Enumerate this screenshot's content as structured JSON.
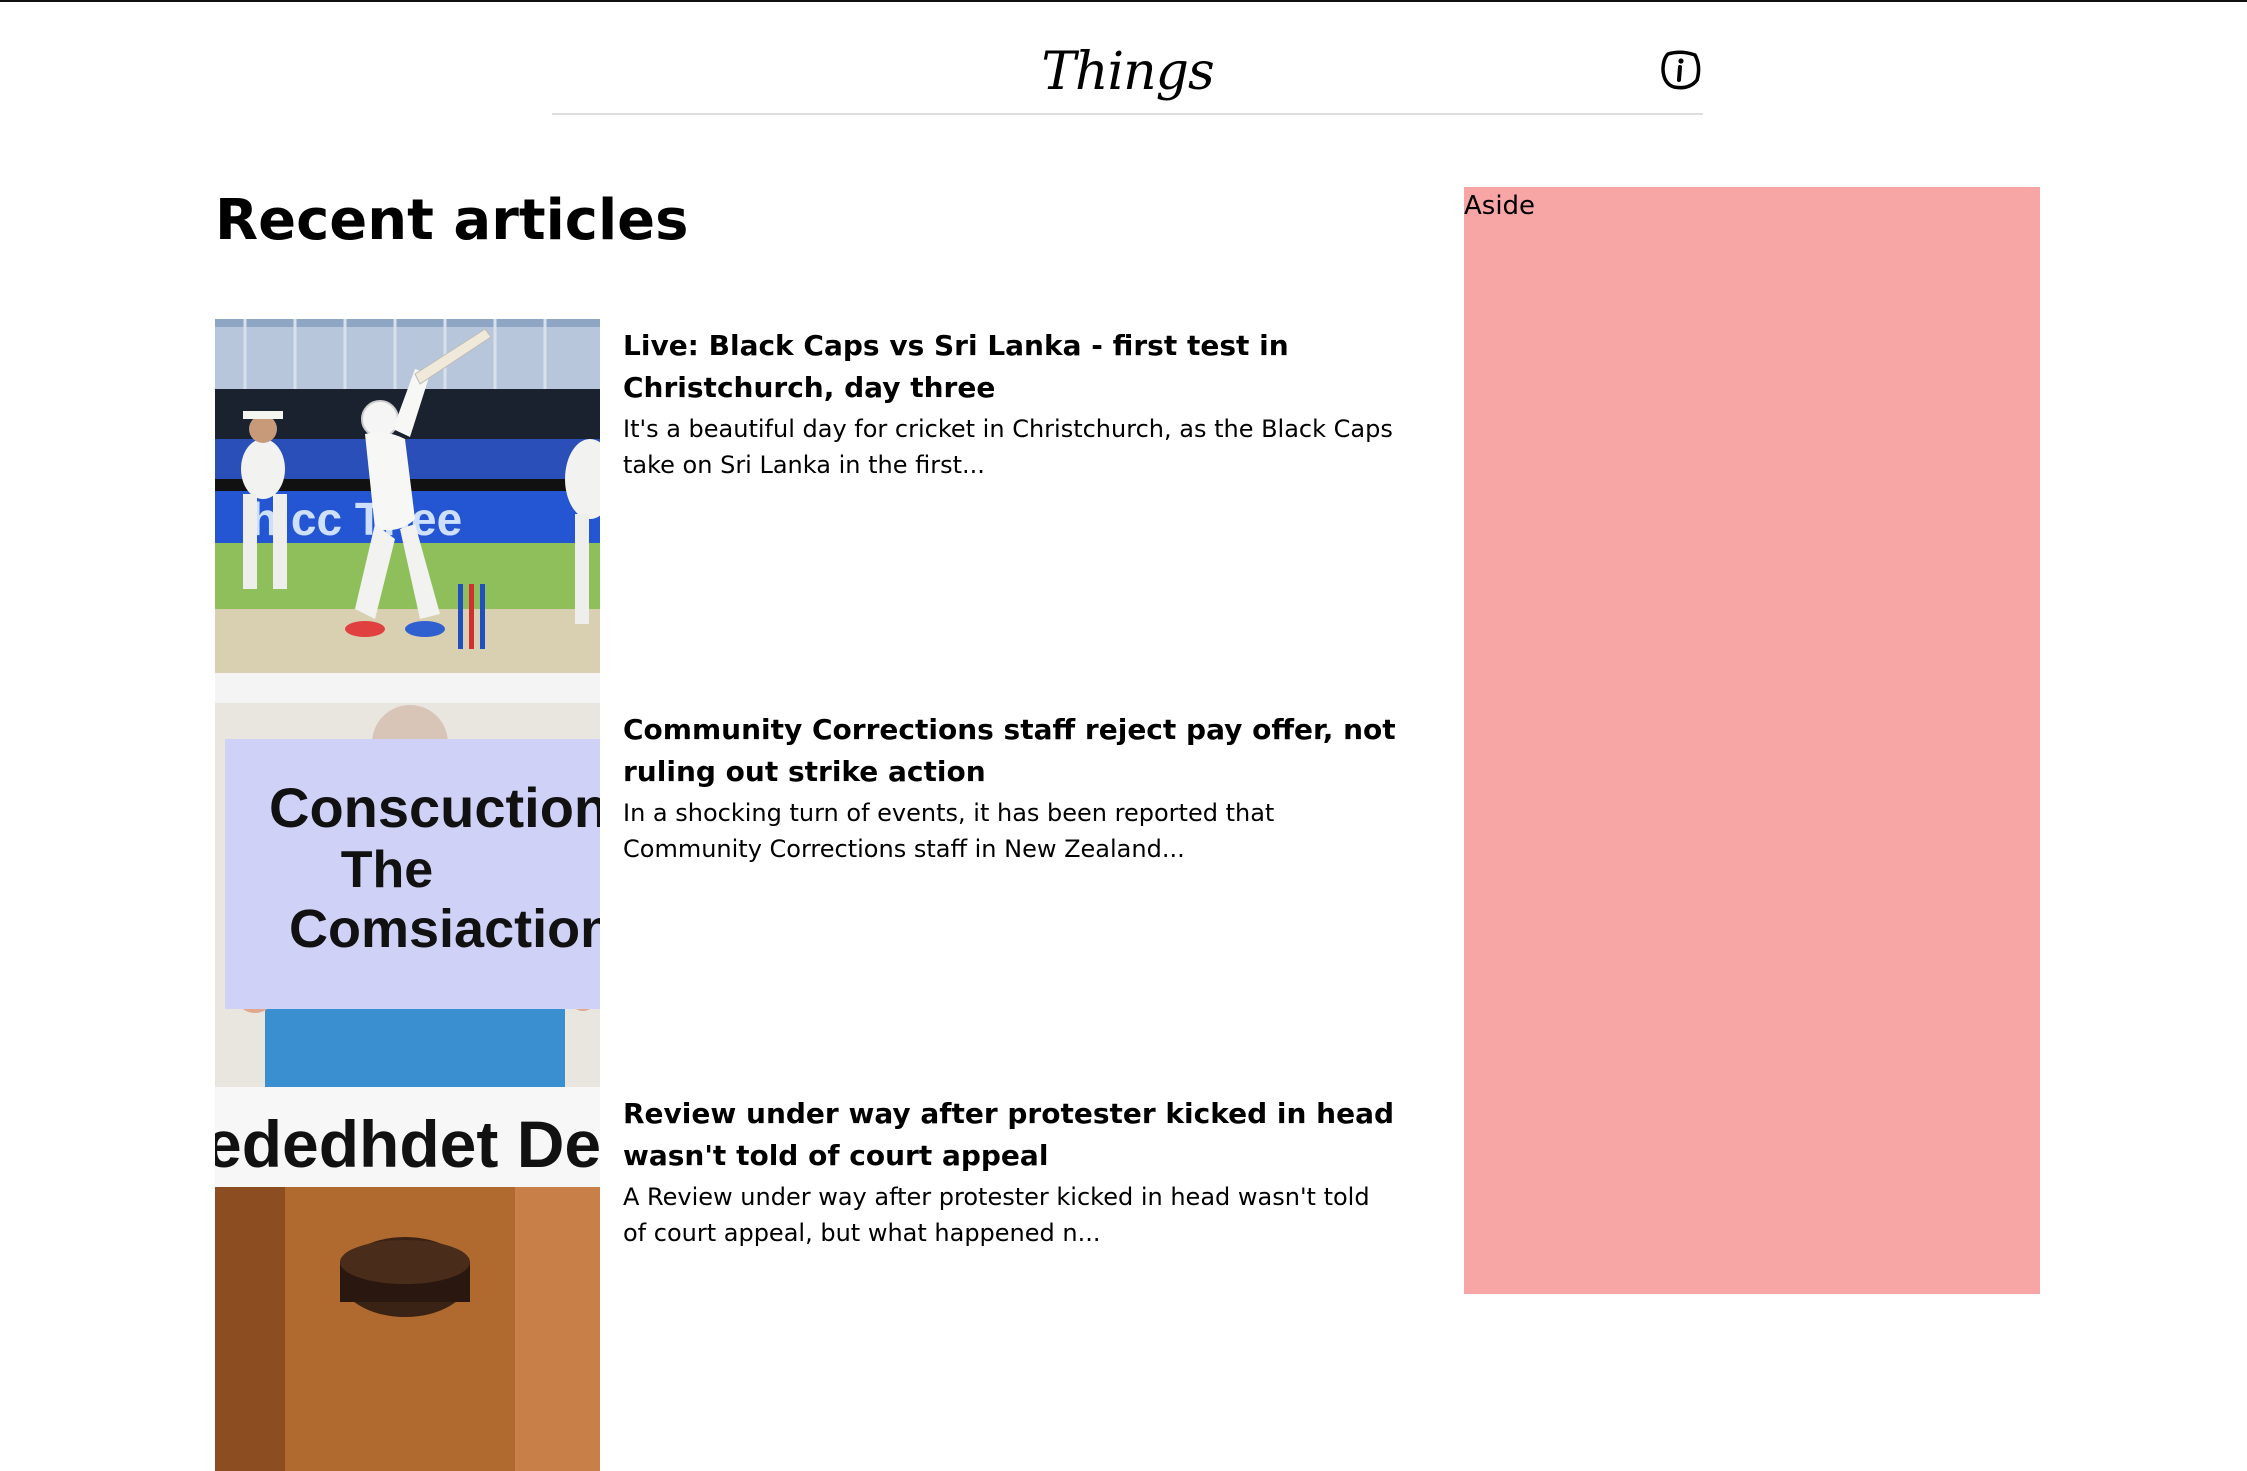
{
  "header": {
    "logo_text": "Things",
    "info_icon": "info-icon"
  },
  "main": {
    "title": "Recent articles",
    "articles": [
      {
        "title": "Live: Black Caps vs Sri Lanka - first test in Christchurch, day three",
        "summary": "It's a beautiful day for cricket in Christchurch, as the Black Caps take on Sri Lanka in the first...",
        "image": "cricket-batsman-image"
      },
      {
        "title": "Community Corrections staff reject pay offer, not ruling out strike action",
        "summary": "In a shocking turn of events, it has been reported that Community Corrections staff in New Zealand...",
        "image": "protest-sign-image",
        "image_sign_lines": [
          "Conscuction",
          "The",
          "Comsiaction"
        ]
      },
      {
        "title": "Review under way after protester kicked in head wasn't told of court appeal",
        "summary": "A Review under way after protester kicked in head wasn't told of court appeal, but what happened n...",
        "image": "gavel-image",
        "image_banner_text": "ededhdet Decw"
      }
    ]
  },
  "aside": {
    "label": "Aside",
    "background": "#f8a5a5"
  }
}
